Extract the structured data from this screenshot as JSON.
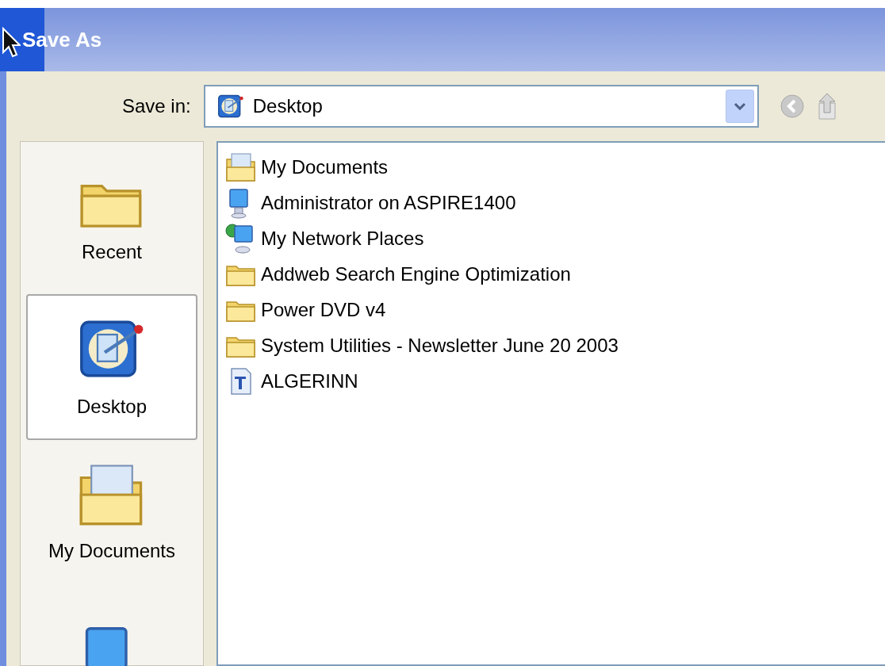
{
  "window": {
    "title": "Save As"
  },
  "save_in": {
    "label": "Save in:",
    "value": "Desktop"
  },
  "places": [
    {
      "kind": "recent",
      "label": "Recent",
      "selected": false
    },
    {
      "kind": "desktop",
      "label": "Desktop",
      "selected": true
    },
    {
      "kind": "documents",
      "label": "My Documents",
      "selected": false
    },
    {
      "kind": "computer",
      "selected": false
    }
  ],
  "files": [
    {
      "kind": "documents",
      "name": "My Documents"
    },
    {
      "kind": "computer",
      "name": "Administrator on ASPIRE1400"
    },
    {
      "kind": "network",
      "name": "My Network Places"
    },
    {
      "kind": "folder",
      "name": "Addweb Search Engine Optimization"
    },
    {
      "kind": "folder",
      "name": "Power DVD v4"
    },
    {
      "kind": "folder",
      "name": "System Utilities - Newsletter June 20 2003"
    },
    {
      "kind": "font",
      "name": "ALGERINN"
    }
  ]
}
